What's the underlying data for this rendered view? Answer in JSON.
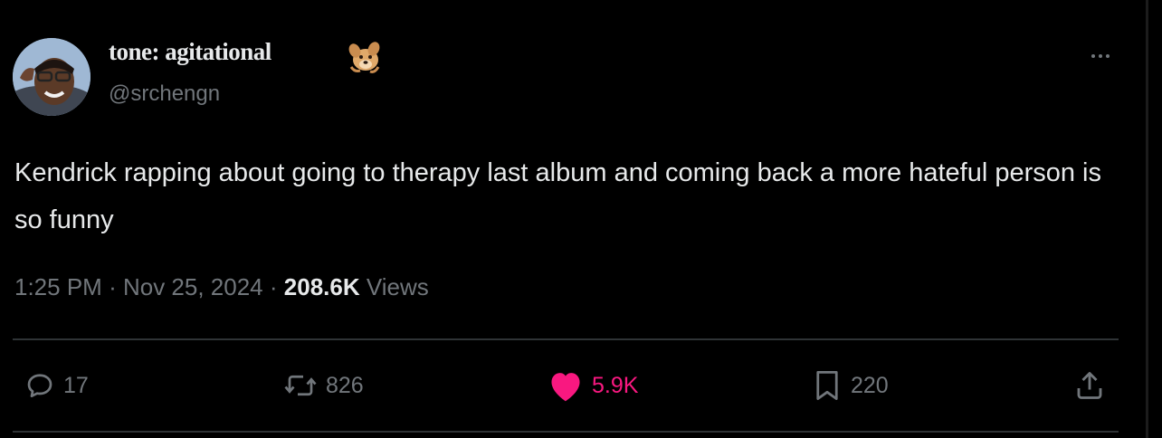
{
  "author": {
    "display_name": "tone: agitational",
    "handle": "@srchengn",
    "badge_icon": "dog-emoji-icon"
  },
  "tweet": {
    "text": "Kendrick rapping about going to therapy last album and coming back a more hateful person is so funny",
    "time": "1:25 PM",
    "date": "Nov 25, 2024",
    "views_count": "208.6K",
    "views_label": "Views",
    "separator": "·"
  },
  "actions": {
    "replies": "17",
    "reposts": "826",
    "likes": "5.9K",
    "bookmarks": "220"
  },
  "colors": {
    "background": "#000000",
    "text_primary": "#e7e9ea",
    "text_secondary": "#71767b",
    "like_active": "#f91880",
    "divider": "#2f3336"
  }
}
